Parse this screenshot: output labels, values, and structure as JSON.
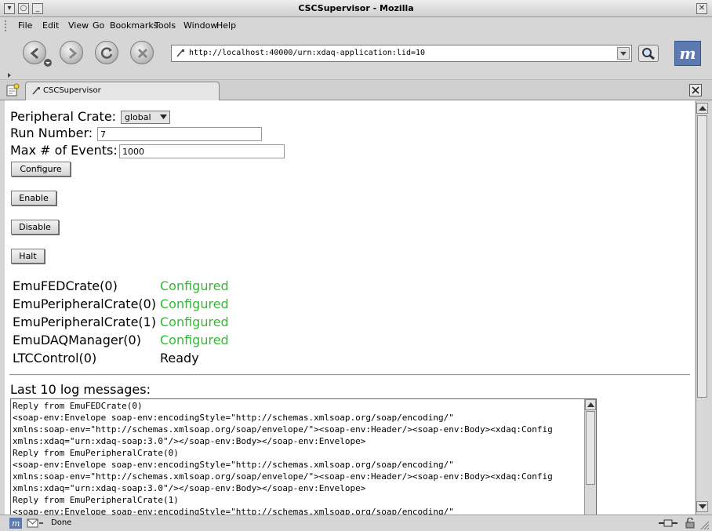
{
  "window": {
    "title": "CSCSupervisor - Mozilla"
  },
  "menu": [
    "File",
    "Edit",
    "View",
    "Go",
    "Bookmarks",
    "Tools",
    "Window",
    "Help"
  ],
  "nav": {
    "url": "http://localhost:40000/urn:xdaq-application:lid=10"
  },
  "tab": {
    "title": "CSCSupervisor"
  },
  "form": {
    "peripheral_crate_label": "Peripheral Crate:",
    "peripheral_crate_value": "global",
    "run_number_label": "Run Number:",
    "run_number_value": "7",
    "max_events_label": "Max # of Events:",
    "max_events_value": "1000",
    "buttons": {
      "configure": "Configure",
      "enable": "Enable",
      "disable": "Disable",
      "halt": "Halt"
    }
  },
  "states": [
    {
      "name": "EmuFEDCrate(0)",
      "state": "Configured",
      "color": "#2ebd2e"
    },
    {
      "name": "EmuPeripheralCrate(0)",
      "state": "Configured",
      "color": "#2ebd2e"
    },
    {
      "name": "EmuPeripheralCrate(1)",
      "state": "Configured",
      "color": "#2ebd2e"
    },
    {
      "name": "EmuDAQManager(0)",
      "state": "Configured",
      "color": "#2ebd2e"
    },
    {
      "name": "LTCControl(0)",
      "state": "Ready",
      "color": "#000000"
    }
  ],
  "log": {
    "heading": "Last 10 log messages:",
    "lines": [
      "Reply from EmuFEDCrate(0)",
      "<soap-env:Envelope soap-env:encodingStyle=\"http://schemas.xmlsoap.org/soap/encoding/\"",
      "xmlns:soap-env=\"http://schemas.xmlsoap.org/soap/envelope/\"><soap-env:Header/><soap-env:Body><xdaq:Config",
      "xmlns:xdaq=\"urn:xdaq-soap:3.0\"/></soap-env:Body></soap-env:Envelope>",
      "Reply from EmuPeripheralCrate(0)",
      "<soap-env:Envelope soap-env:encodingStyle=\"http://schemas.xmlsoap.org/soap/encoding/\"",
      "xmlns:soap-env=\"http://schemas.xmlsoap.org/soap/envelope/\"><soap-env:Header/><soap-env:Body><xdaq:Config",
      "xmlns:xdaq=\"urn:xdaq-soap:3.0\"/></soap-env:Body></soap-env:Envelope>",
      "Reply from EmuPeripheralCrate(1)",
      "<soap-env:Envelope soap-env:encodingStyle=\"http://schemas.xmlsoap.org/soap/encoding/\""
    ]
  },
  "status": {
    "text": "Done"
  },
  "icons": {
    "back": "back-arrow-icon",
    "forward": "forward-arrow-icon",
    "reload": "reload-icon",
    "stop": "stop-icon",
    "search": "magnifier-icon",
    "throbber": "mozilla-m-icon"
  }
}
